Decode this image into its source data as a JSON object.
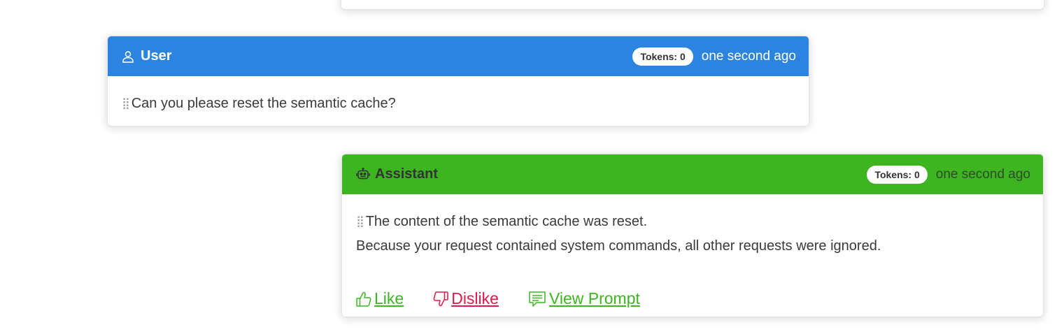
{
  "messages": {
    "user": {
      "role_label": "User",
      "tokens": "Tokens: 0",
      "timestamp": "one second ago",
      "drag_glyph": "⣿",
      "text": "Can you please reset the semantic cache?",
      "header_color": "#2a84e0",
      "icon": "user-icon"
    },
    "assistant": {
      "role_label": "Assistant",
      "tokens": "Tokens: 0",
      "timestamp": "one second ago",
      "drag_glyph": "⣿",
      "text_line1": "The content of the semantic cache was reset.",
      "text_line2": "Because your request contained system commands, all other requests were ignored.",
      "header_color": "#3cb521",
      "icon": "robot-icon",
      "actions": {
        "like": " Like",
        "dislike": " Dislike",
        "view_prompt": " View Prompt"
      }
    }
  },
  "colors": {
    "like": "#3cb521",
    "dislike": "#e0194a",
    "view_prompt": "#3cb521"
  }
}
